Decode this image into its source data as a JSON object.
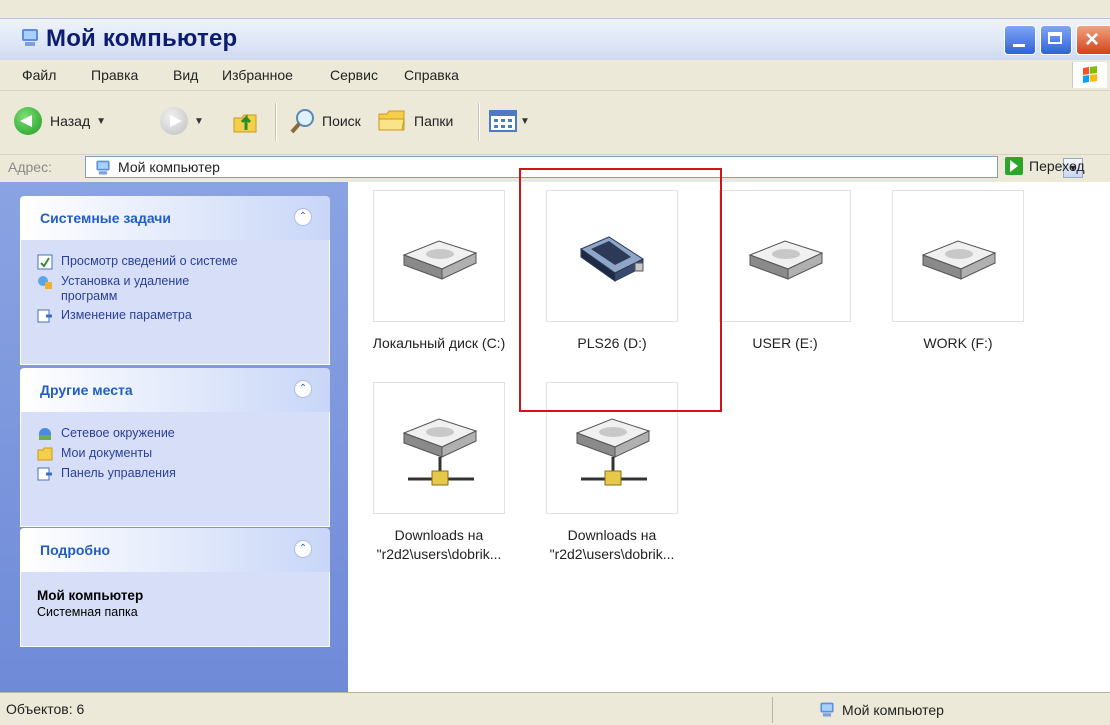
{
  "window": {
    "title": "Мой компьютер"
  },
  "menu": [
    "Файл",
    "Правка",
    "Вид",
    "Избранное",
    "Сервис",
    "Справка"
  ],
  "toolbar": {
    "back": "Назад",
    "search": "Поиск",
    "folders": "Папки"
  },
  "address": {
    "label": "Адрес:",
    "value": "Мой компьютер",
    "go": "Переход"
  },
  "panels": {
    "system_tasks": {
      "title": "Системные задачи",
      "items": [
        "Просмотр сведений о системе",
        "Установка и удаление программ",
        "Изменение параметра"
      ]
    },
    "other_places": {
      "title": "Другие места",
      "items": [
        "Сетевое окружение",
        "Мои документы",
        "Панель управления"
      ]
    },
    "details": {
      "title": "Подробно",
      "name": "Мой компьютер",
      "type": "Системная папка"
    }
  },
  "drives": [
    {
      "label": "Локальный диск (C:)",
      "icon": "hard-drive-icon"
    },
    {
      "label": "PLS26 (D:)",
      "icon": "removable-drive-icon"
    },
    {
      "label": "USER (E:)",
      "icon": "hard-drive-icon"
    },
    {
      "label": "WORK (F:)",
      "icon": "hard-drive-icon"
    },
    {
      "label": "Downloads на \"r2d2\\users\\dobrik...",
      "icon": "network-drive-icon"
    },
    {
      "label": "Downloads на \"r2d2\\users\\dobrik...",
      "icon": "network-drive-icon"
    }
  ],
  "status": {
    "objects": "Объектов: 6",
    "location": "Мой компьютер"
  }
}
